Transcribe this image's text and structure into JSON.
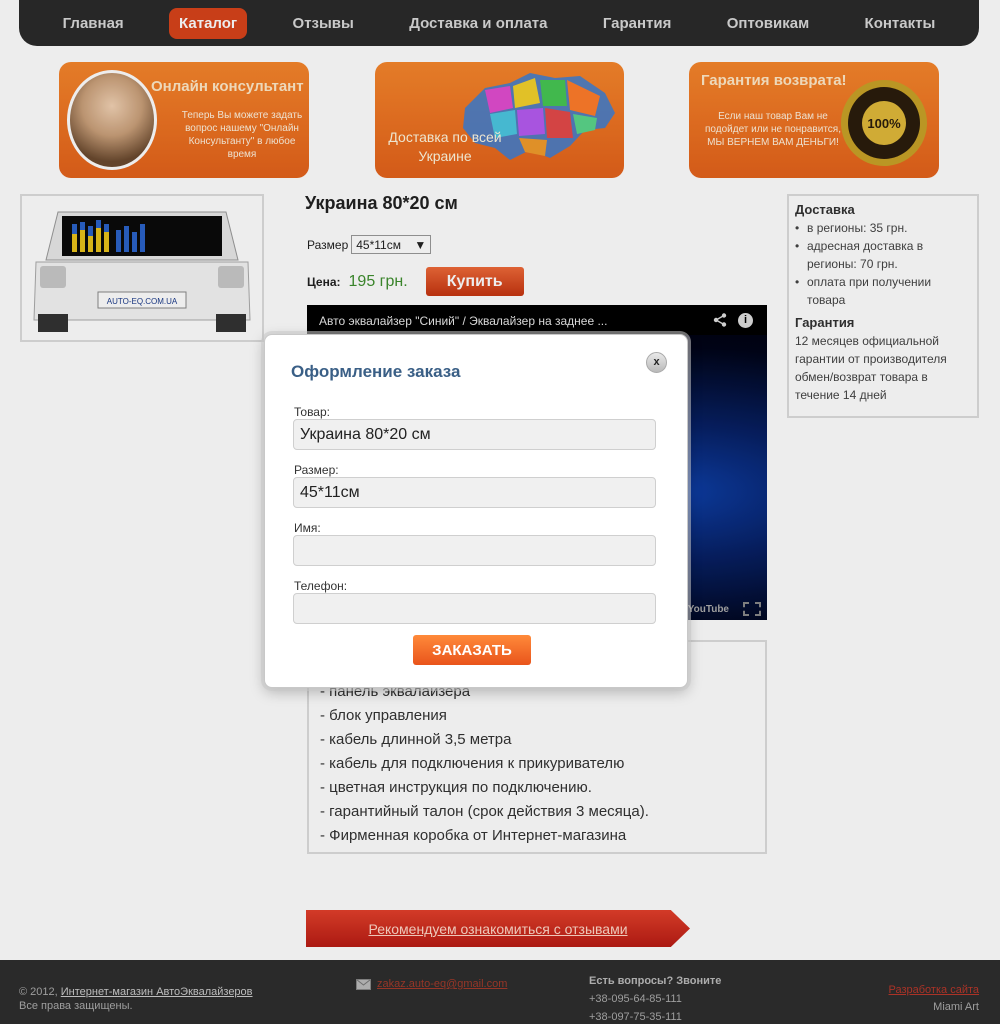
{
  "nav": {
    "items": [
      {
        "label": "Главная"
      },
      {
        "label": "Каталог"
      },
      {
        "label": "Отзывы"
      },
      {
        "label": "Доставка и оплата"
      },
      {
        "label": "Гарантия"
      },
      {
        "label": "Оптовикам"
      },
      {
        "label": "Контакты"
      }
    ],
    "active": "Каталог"
  },
  "banners": {
    "consultant": {
      "title": "Онлайн консультант",
      "text": "Теперь Вы можете задать вопрос нашему \"Онлайн Консультанту\" в любое время"
    },
    "delivery": {
      "title": "Доставка по всей Украине"
    },
    "guarantee": {
      "title": "Гарантия возврата!",
      "text": "Если наш товар Вам не подойдет или не понравится, МЫ ВЕРНЕМ ВАМ ДЕНЬГИ!",
      "seal_text": "100%"
    }
  },
  "product": {
    "title": "Украина 80*20 см",
    "size_label": "Размер",
    "size_value": "45*11см",
    "price_label": "Цена:",
    "price": "195 грн.",
    "buy_label": "Купить",
    "thumb_plate": "AUTO-EQ.COM.UA"
  },
  "video": {
    "title": "Авто эквалайзер \"Синий\" / Эквалайзер на заднее ...",
    "info_glyph": "i",
    "yt_label": "YouTube"
  },
  "description": {
    "lines": [
      "- панель эквалайзера",
      "- блок управления",
      "- кабель длинной 3,5 метра",
      "- кабель для подключения к прикуривателю",
      "- цветная инструкция по подключению.",
      "- гарантийный талон (срок действия 3 месяца).",
      "- Фирменная коробка от Интернет-магазина"
    ]
  },
  "sidebar": {
    "delivery_title": "Доставка",
    "delivery_items": [
      "в регионы: 35 грн.",
      "адресная доставка в регионы: 70 грн.",
      "оплата при получении товара"
    ],
    "guarantee_title": "Гарантия",
    "guarantee_text": "12 месяцев официальной гарантии от производителя обмен/возврат товара в течение 14 дней"
  },
  "recommend": {
    "label": "Рекомендуем ознакомиться с отзывами"
  },
  "footer": {
    "copy_prefix": "© 2012,",
    "copy_link": "Интернет-магазин АвтоЭквалайзеров",
    "rights": "Все права защищены.",
    "email": "zakaz.auto-eq@gmail.com",
    "phone_title": "Есть вопросы? Звоните",
    "phone1": "+38-095-64-85-111",
    "phone2": "+38-097-75-35-111",
    "dev_link": "Разработка сайта",
    "dev_name": "Miami Art"
  },
  "modal": {
    "title": "Оформление заказа",
    "close_label": "x",
    "product_label": "Товар:",
    "product_value": "Украина 80*20 см",
    "size_label": "Размер:",
    "size_value": "45*11см",
    "name_label": "Имя:",
    "name_value": "",
    "phone_label": "Телефон:",
    "phone_value": "",
    "submit_label": "ЗАКАЗАТЬ"
  },
  "colors": {
    "nav_bg": "#2b2b2b",
    "accent_orange": "#e4621b",
    "modal_title": "#3a5f86",
    "price_green": "#3f8f2f"
  }
}
